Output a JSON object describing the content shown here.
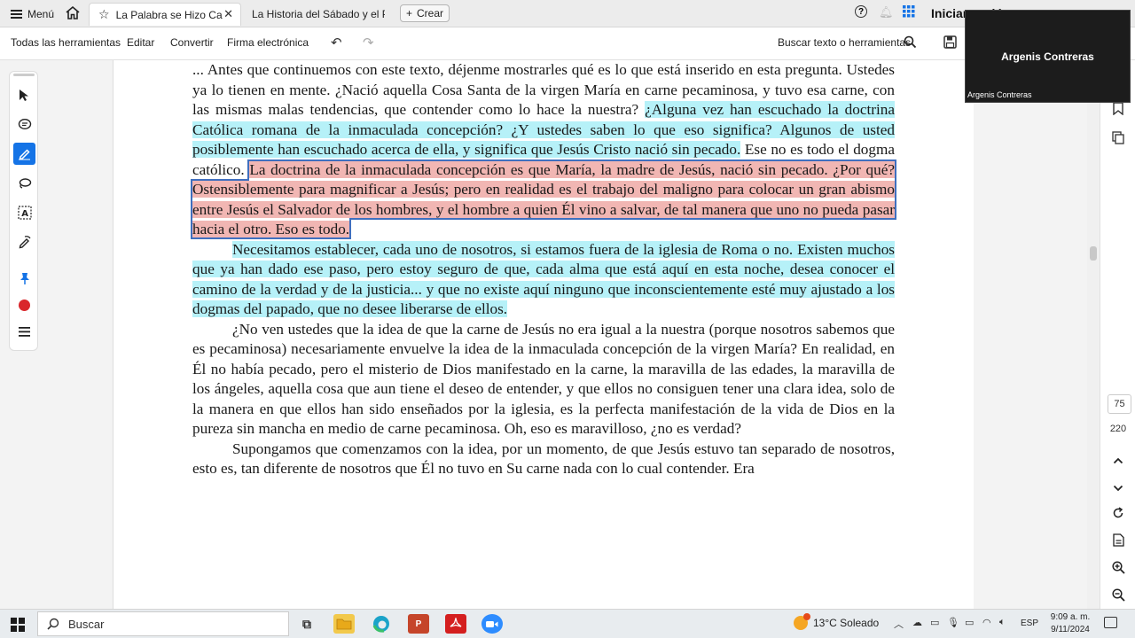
{
  "tabbar": {
    "menu_label": "Menú",
    "tabs": [
      {
        "label": "La Palabra se Hizo Carne",
        "active": true
      },
      {
        "label": "La Historia del Sábado y el Primer Día de la Semana",
        "active": false
      }
    ],
    "create_label": "Crear",
    "signin_label": "Iniciar sesión"
  },
  "toolbar": {
    "all_tools": "Todas las herramientas",
    "edit": "Editar",
    "convert": "Convertir",
    "esign": "Firma electrónica",
    "search_tools": "Buscar texto o herramientas"
  },
  "document": {
    "paragraphs": [
      {
        "indent": false,
        "segments": [
          {
            "text": "... Antes que continuemos con este texto, déjenme mostrarles qué es lo que está inserido en esta pregunta. Ustedes ya lo tienen en mente. ¿Nació aquella Cosa Santa de la virgen María en carne pecaminosa, y tuvo esa carne, con las mismas malas tendencias, que contender como lo hace la nuestra? ",
            "hl": "none"
          },
          {
            "text": "¿Alguna vez han escuchado la doctrina Católica romana de la inmaculada concepción? ¿Y ustedes saben lo que eso significa? Algunos de usted posiblemente han escuchado acerca de ella, y significa que Jesús Cristo nació sin pecado.",
            "hl": "cyan"
          },
          {
            "text": " Ese no es todo el dogma católico. ",
            "hl": "none"
          },
          {
            "text": "La doctrina de la inmaculada concepción es que María, la madre de Jesús, nació sin pecado. ¿Por qué? Ostensiblemente para magnificar a Jesús; pero en realidad es el trabajo del maligno para colocar un gran abismo entre Jesús el Salvador de los hombres, y el hombre a quien Él vino a salvar, de tal manera que uno no pueda pasar hacia el otro. Eso es todo.",
            "hl": "red"
          }
        ]
      },
      {
        "indent": true,
        "segments": [
          {
            "text": "Necesitamos establecer, cada uno de nosotros, si estamos fuera de la iglesia de Roma o no. Existen muchos que ya han dado ese paso, pero estoy seguro de que, cada alma que está aquí en esta noche, desea conocer el camino de la verdad y de la justicia... y que no existe aquí ninguno que inconscientemente esté muy ajustado a los dogmas del papado, que no desee liberarse de ellos.",
            "hl": "cyan"
          }
        ]
      },
      {
        "indent": true,
        "segments": [
          {
            "text": "¿No ven ustedes que la idea de que la carne de Jesús no era igual a la nuestra (porque nosotros sabemos que es pecaminosa) necesariamente envuelve la idea de la inmaculada concepción de la virgen María? En realidad, en Él no había pecado, pero el misterio de Dios manifestado en la carne, la maravilla de las edades, la maravilla de los ángeles, aquella cosa que aun tiene el deseo de entender, y que ellos no consiguen tener una clara idea, solo de la manera en que ellos han sido enseñados por la iglesia, es la perfecta manifestación de la vida de Dios en la pureza sin mancha en medio de carne pecaminosa. Oh, eso es maravilloso, ¿no es verdad?",
            "hl": "none"
          }
        ]
      },
      {
        "indent": true,
        "segments": [
          {
            "text": "Supongamos que comenzamos con la idea, por un momento, de que Jesús estuvo tan separado de nosotros, esto es, tan diferente de nosotros que Él no tuvo en Su carne nada con lo cual contender. Era",
            "hl": "none"
          }
        ]
      }
    ]
  },
  "navigation": {
    "current_page": "75",
    "total_pages": "220"
  },
  "video": {
    "participant": "Argenis Contreras",
    "label": "Argenis Contreras"
  },
  "taskbar": {
    "search_label": "Buscar",
    "weather": "13°C Soleado",
    "language": "ESP",
    "time": "9:09 a. m.",
    "date": "9/11/2024"
  },
  "colors": {
    "highlight_cyan": "#b6f1f8",
    "highlight_red": "#f1b6b3",
    "selection_outline": "#3f6fbf",
    "accent": "#1473e6"
  }
}
